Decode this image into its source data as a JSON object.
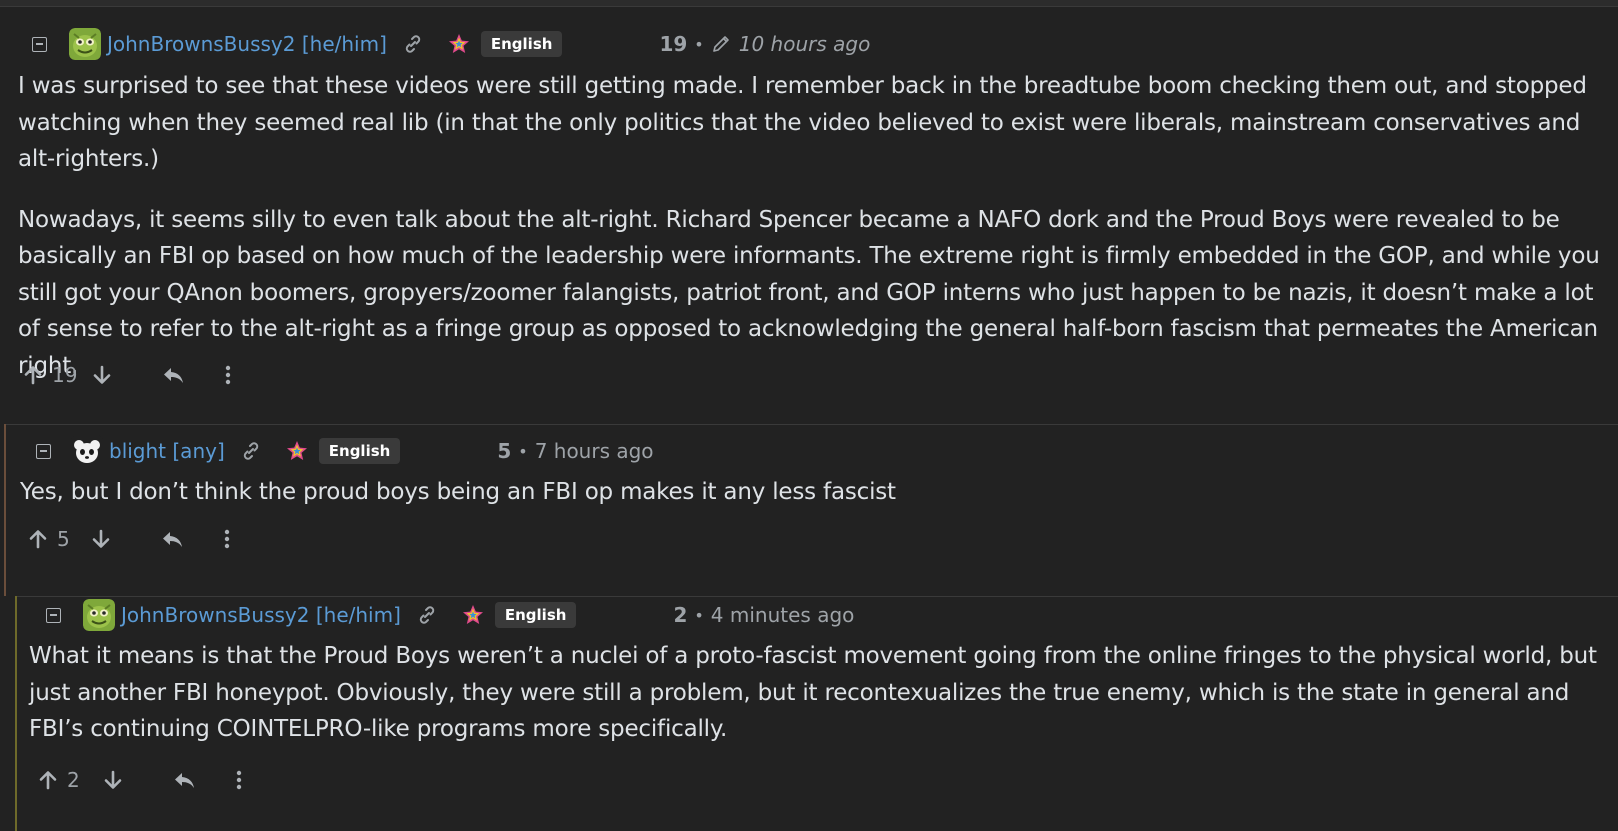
{
  "comments": [
    {
      "username": "JohnBrownsBussy2 [he/him]",
      "language": "English",
      "score": "19",
      "time": "10 hours ago",
      "edited": true,
      "paragraphs": [
        "I was surprised to see that these videos were still getting made. I remember back in the breadtube boom checking them out, and stopped watching when they seemed real lib (in that the only politics that the video believed to exist were liberals, mainstream conservatives and alt-righters.)",
        "Nowadays, it seems silly to even talk about the alt-right. Richard Spencer became a NAFO dork and the Proud Boys were revealed to be basically an FBI op based on how much of the leadership were informants. The extreme right is firmly embedded in the GOP, and while you still got your QAnon boomers, gropyers/zoomer falangists, patriot front, and GOP interns who just happen to be nazis, it doesn’t make a lot of sense to refer to the alt-right as a fringe group as opposed to acknowledging the general half-born fascism that permeates the American right."
      ],
      "upvotes": "19"
    },
    {
      "username": "blight [any]",
      "language": "English",
      "score": "5",
      "time": "7 hours ago",
      "edited": false,
      "paragraphs": [
        "Yes, but I don’t think the proud boys being an FBI op makes it any less fascist"
      ],
      "upvotes": "5"
    },
    {
      "username": "JohnBrownsBussy2 [he/him]",
      "language": "English",
      "score": "2",
      "time": "4 minutes ago",
      "edited": false,
      "paragraphs": [
        "What it means is that the Proud Boys weren’t a nuclei of a proto-fascist movement going from the online fringes to the physical world, but just another FBI honeypot. Obviously, they were still a problem, but it recontexualizes the true enemy, which is the state in general and FBI’s continuing COINTELPRO-like programs more specifically."
      ],
      "upvotes": "2"
    }
  ],
  "icons": {
    "collapse": "collapse-minus-icon",
    "link": "link-icon",
    "flair": "pride-star-icon",
    "edit": "pencil-icon",
    "upvote": "arrow-up-icon",
    "downvote": "arrow-down-icon",
    "reply": "reply-icon",
    "more": "more-vertical-icon"
  },
  "colors": {
    "background": "#222222",
    "username": "#5b9bd5",
    "text": "#dee2e6",
    "muted": "#9ea3a8",
    "badge": "#3a3a3a"
  }
}
